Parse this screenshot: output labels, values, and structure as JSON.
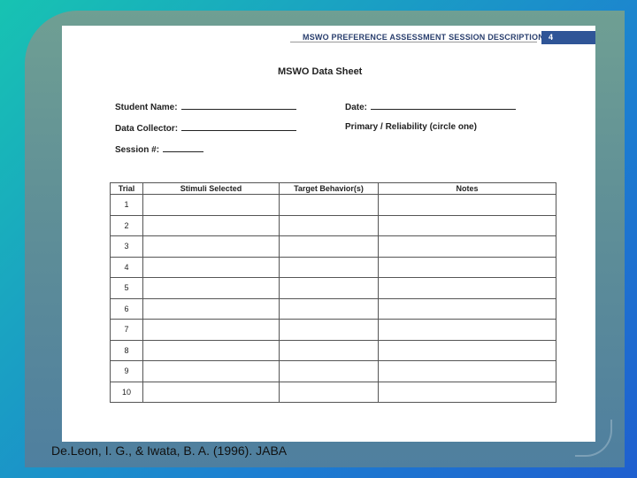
{
  "header": {
    "title": "MSWO PREFERENCE ASSESSMENT SESSION DESCRIPTION",
    "page_number": "4"
  },
  "document": {
    "title": "MSWO Data Sheet",
    "fields": {
      "student_name": "Student Name:",
      "date": "Date:",
      "data_collector": "Data Collector:",
      "primary_reliability": "Primary / Reliability (circle one)",
      "session": "Session #:"
    },
    "table": {
      "columns": [
        "Trial",
        "Stimuli Selected",
        "Target Behavior(s)",
        "Notes"
      ],
      "trials": [
        "1",
        "2",
        "3",
        "4",
        "5",
        "6",
        "7",
        "8",
        "9",
        "10"
      ]
    }
  },
  "citation": "De.Leon, I. G., & Iwata, B. A. (1996). JABA",
  "colors": {
    "badge": "#2f5597",
    "header_text": "#2a3f6e"
  }
}
